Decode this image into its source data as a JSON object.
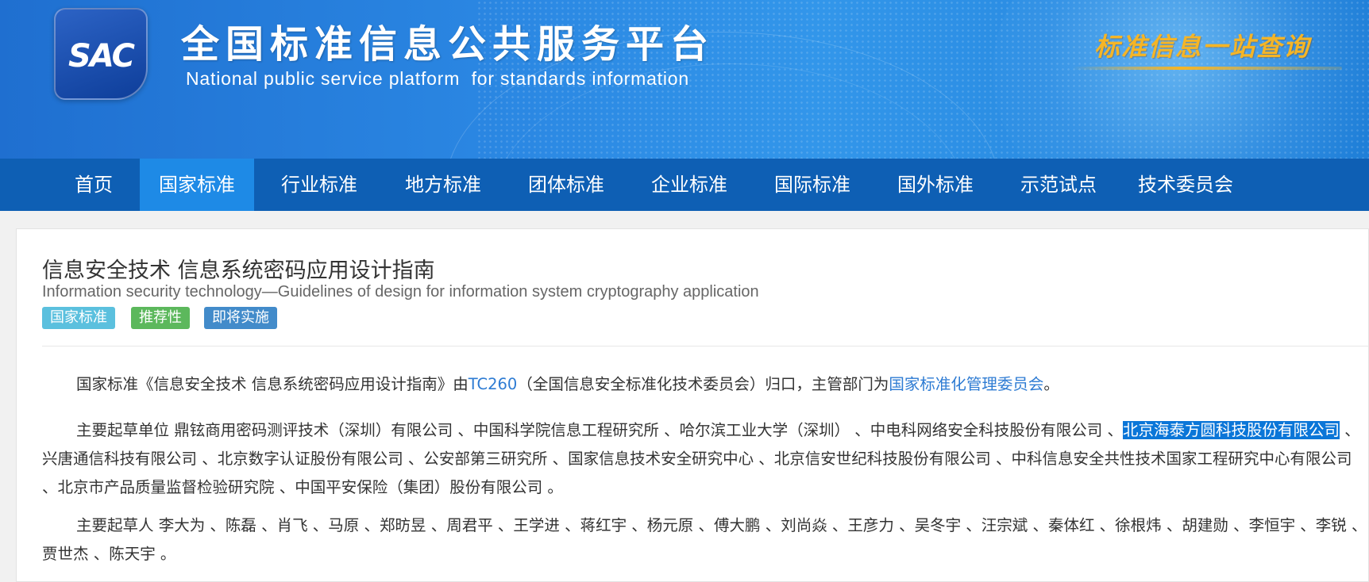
{
  "header": {
    "logo_text": "SAC",
    "title": "全国标准信息公共服务平台",
    "subtitle": "National public service platform  for standards information",
    "slogan": "标准信息一站查询",
    "colors": {
      "banner": "#2a86e2",
      "nav": "#0e5fb4",
      "nav_active": "#1e8ae6",
      "slogan": "#f5b526"
    }
  },
  "nav": {
    "items": [
      {
        "label": "首页"
      },
      {
        "label": "国家标准",
        "active": true
      },
      {
        "label": "行业标准"
      },
      {
        "label": "地方标准"
      },
      {
        "label": "团体标准"
      },
      {
        "label": "企业标准"
      },
      {
        "label": "国际标准"
      },
      {
        "label": "国外标准"
      },
      {
        "label": "示范试点"
      },
      {
        "label": "技术委员会"
      }
    ]
  },
  "standard": {
    "title_cn": "信息安全技术 信息系统密码应用设计指南",
    "title_en": "Information security technology—Guidelines of design for information system cryptography application",
    "badges": [
      {
        "label": "国家标准",
        "color": "#5bc0de"
      },
      {
        "label": "推荐性",
        "color": "#5cb85c"
      },
      {
        "label": "即将实施",
        "color": "#428bca"
      }
    ],
    "intro": {
      "prefix": "国家标准《信息安全技术 信息系统密码应用设计指南》由",
      "tc_link": "TC260",
      "middle": "（全国信息安全标准化技术委员会）归口，主管部门为",
      "dept_link": "国家标准化管理委员会",
      "suffix": "。"
    },
    "drafting_units": {
      "label": "主要起草单位 ",
      "before": "鼎铉商用密码测评技术（深圳）有限公司 、中国科学院信息工程研究所 、哈尔滨工业大学（深圳） 、中电科网络安全科技股份有限公司 、",
      "highlighted": "北京海泰方圆科技股份有限公司",
      "after": " 、兴唐通信科技有限公司 、北京数字认证股份有限公司 、公安部第三研究所 、国家信息技术安全研究中心 、北京信安世纪科技股份有限公司 、中科信息安全共性技术国家工程研究中心有限公司 、北京市产品质量监督检验研究院 、中国平安保险（集团）股份有限公司 。"
    },
    "drafters": {
      "label": "主要起草人 ",
      "names": "李大为 、陈磊 、肖飞 、马原 、郑昉昱 、周君平 、王学进 、蒋红宇 、杨元原 、傅大鹏 、刘尚焱 、王彦力 、吴冬宇 、汪宗斌 、秦体红 、徐根炜 、胡建勋 、李恒宇 、李锐 、贾世杰 、陈天宇 。"
    }
  }
}
